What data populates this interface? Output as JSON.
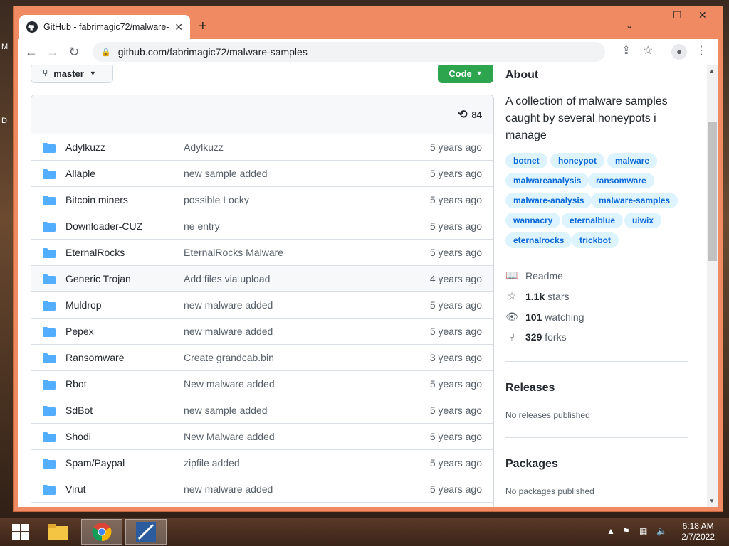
{
  "desktop": {
    "left_labels": [
      "M",
      "D"
    ]
  },
  "browser": {
    "tab_title": "GitHub - fabrimagic72/malware-",
    "tab_close": "✕",
    "new_tab": "+",
    "url": "github.com/fabrimagic72/malware-samples",
    "win_min": "—",
    "win_max": "☐",
    "win_close": "✕"
  },
  "repo": {
    "branch_label": "master",
    "code_label": "Code",
    "commit_count": "84",
    "files": [
      {
        "name": "Adylkuzz",
        "message": "Adylkuzz",
        "age": "5 years ago"
      },
      {
        "name": "Allaple",
        "message": "new sample added",
        "age": "5 years ago"
      },
      {
        "name": "Bitcoin miners",
        "message": "possible Locky",
        "age": "5 years ago"
      },
      {
        "name": "Downloader-CUZ",
        "message": "ne entry",
        "age": "5 years ago"
      },
      {
        "name": "EternalRocks",
        "message": "EternalRocks Malware",
        "age": "5 years ago"
      },
      {
        "name": "Generic Trojan",
        "message": "Add files via upload",
        "age": "4 years ago"
      },
      {
        "name": "Muldrop",
        "message": "new malware added",
        "age": "5 years ago"
      },
      {
        "name": "Pepex",
        "message": "new malware added",
        "age": "5 years ago"
      },
      {
        "name": "Ransomware",
        "message": "Create grandcab.bin",
        "age": "3 years ago"
      },
      {
        "name": "Rbot",
        "message": "New malware added",
        "age": "5 years ago"
      },
      {
        "name": "SdBot",
        "message": "new sample added",
        "age": "5 years ago"
      },
      {
        "name": "Shodi",
        "message": "New Malware added",
        "age": "5 years ago"
      },
      {
        "name": "Spam/Paypal",
        "message": "zipfile added",
        "age": "5 years ago"
      },
      {
        "name": "Virut",
        "message": "new malware added",
        "age": "5 years ago"
      }
    ]
  },
  "about": {
    "heading": "About",
    "description": "A collection of malware samples caught by several honeypots i manage",
    "topics": [
      "botnet",
      "honeypot",
      "malware",
      "malwareanalysis",
      "ransomware",
      "malware-analysis",
      "malware-samples",
      "wannacry",
      "eternalblue",
      "uiwix",
      "eternalrocks",
      "trickbot"
    ],
    "readme": "Readme",
    "stars_count": "1.1k",
    "stars_label": "stars",
    "watching_count": "101",
    "watching_label": "watching",
    "forks_count": "329",
    "forks_label": "forks"
  },
  "releases": {
    "heading": "Releases",
    "text": "No releases published"
  },
  "packages": {
    "heading": "Packages",
    "text": "No packages published"
  },
  "taskbar": {
    "time": "6:18 AM",
    "date": "2/7/2022"
  }
}
